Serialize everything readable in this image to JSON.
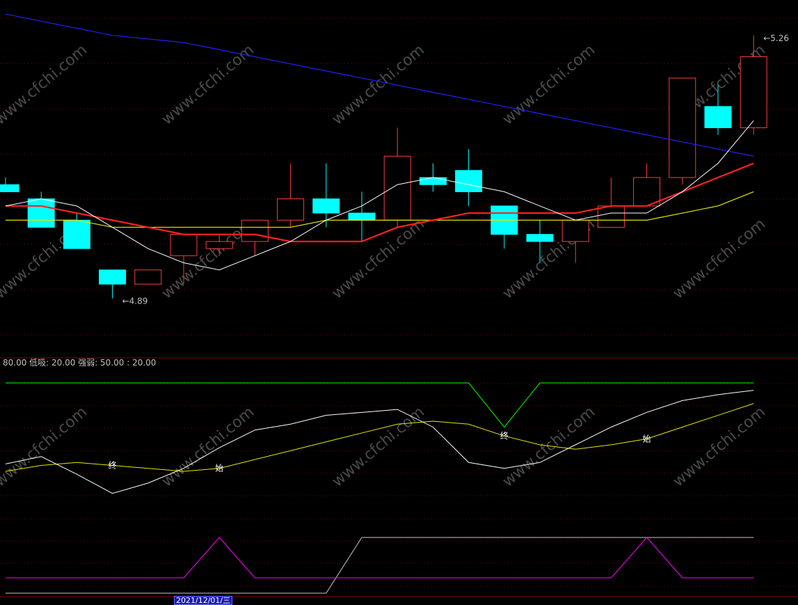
{
  "indicator_text": "80.00  低吸: 20.00  强弱: 50.00 : 20.00",
  "date_label": "2021/12/01/三",
  "watermark": "www.cfchi.com",
  "colors": {
    "bg": "#000000",
    "up": "#ff3c3c",
    "down": "#00ffff",
    "ma5": "#ffffff",
    "ma10": "#ff2020",
    "ma20": "#e8e800",
    "ma60": "#2020ff",
    "grid": "#800000",
    "osc_top": "#00ff00",
    "osc_k": "#ffffff",
    "osc_d": "#e8e800",
    "signal_magenta": "#ff00ff",
    "signal_white": "#c8c8c8"
  },
  "chart_data": [
    {
      "type": "candlestick",
      "title": "",
      "ylim": [
        4.82,
        5.3
      ],
      "candles": [
        {
          "o": 5.05,
          "h": 5.06,
          "l": 5.04,
          "c": 5.04
        },
        {
          "o": 5.03,
          "h": 5.04,
          "l": 4.99,
          "c": 4.99
        },
        {
          "o": 5.0,
          "h": 5.01,
          "l": 4.96,
          "c": 4.96
        },
        {
          "o": 4.93,
          "h": 4.93,
          "l": 4.89,
          "c": 4.91
        },
        {
          "o": 4.91,
          "h": 4.93,
          "l": 4.91,
          "c": 4.93
        },
        {
          "o": 4.95,
          "h": 4.98,
          "l": 4.91,
          "c": 4.98
        },
        {
          "o": 4.96,
          "h": 4.98,
          "l": 4.95,
          "c": 4.97
        },
        {
          "o": 4.97,
          "h": 5.0,
          "l": 4.95,
          "c": 5.0
        },
        {
          "o": 5.0,
          "h": 5.08,
          "l": 4.99,
          "c": 5.03
        },
        {
          "o": 5.03,
          "h": 5.08,
          "l": 4.99,
          "c": 5.01
        },
        {
          "o": 5.01,
          "h": 5.04,
          "l": 4.97,
          "c": 5.0
        },
        {
          "o": 5.0,
          "h": 5.13,
          "l": 4.99,
          "c": 5.09
        },
        {
          "o": 5.06,
          "h": 5.08,
          "l": 5.04,
          "c": 5.05
        },
        {
          "o": 5.07,
          "h": 5.1,
          "l": 5.02,
          "c": 5.04
        },
        {
          "o": 5.02,
          "h": 5.02,
          "l": 4.96,
          "c": 4.98
        },
        {
          "o": 4.98,
          "h": 5.0,
          "l": 4.94,
          "c": 4.97
        },
        {
          "o": 4.97,
          "h": 5.0,
          "l": 4.94,
          "c": 5.0
        },
        {
          "o": 4.99,
          "h": 5.06,
          "l": 4.99,
          "c": 5.02
        },
        {
          "o": 5.02,
          "h": 5.08,
          "l": 5.02,
          "c": 5.06
        },
        {
          "o": 5.06,
          "h": 5.2,
          "l": 5.05,
          "c": 5.2
        },
        {
          "o": 5.16,
          "h": 5.19,
          "l": 5.12,
          "c": 5.13
        },
        {
          "o": 5.13,
          "h": 5.26,
          "l": 5.12,
          "c": 5.23
        }
      ],
      "ma5": [
        5.02,
        5.03,
        5.02,
        4.99,
        4.96,
        4.94,
        4.93,
        4.95,
        4.97,
        5.0,
        5.02,
        5.05,
        5.06,
        5.05,
        5.04,
        5.02,
        5.0,
        5.01,
        5.01,
        5.04,
        5.08,
        5.14
      ],
      "ma10": [
        5.02,
        5.02,
        5.01,
        5.0,
        4.99,
        4.98,
        4.98,
        4.98,
        4.97,
        4.97,
        4.97,
        4.99,
        5.0,
        5.01,
        5.01,
        5.01,
        5.01,
        5.02,
        5.02,
        5.04,
        5.06,
        5.08
      ],
      "ma20": [
        5.0,
        5.0,
        5.0,
        4.99,
        4.99,
        4.99,
        4.99,
        4.99,
        4.99,
        5.0,
        5.0,
        5.0,
        5.0,
        5.0,
        5.0,
        5.0,
        5.0,
        5.0,
        5.0,
        5.01,
        5.02,
        5.04
      ],
      "ma60": [
        5.29,
        5.28,
        5.27,
        5.26,
        5.255,
        5.25,
        5.24,
        5.23,
        5.22,
        5.21,
        5.2,
        5.19,
        5.18,
        5.17,
        5.16,
        5.15,
        5.14,
        5.13,
        5.12,
        5.11,
        5.1,
        5.09
      ],
      "annotations": [
        {
          "label": "5.26",
          "index": 21,
          "value": 5.26
        },
        {
          "label": "4.89",
          "index": 3,
          "value": 4.89
        }
      ]
    },
    {
      "type": "line",
      "title": "",
      "ylim": [
        0,
        100
      ],
      "top_line": [
        100,
        100,
        100,
        100,
        100,
        100,
        100,
        100,
        100,
        100,
        100,
        100,
        100,
        100,
        70,
        100,
        100,
        100,
        100,
        100,
        100,
        100
      ],
      "k": [
        45,
        50,
        38,
        25,
        32,
        42,
        56,
        68,
        72,
        78,
        80,
        82,
        70,
        46,
        42,
        46,
        58,
        70,
        80,
        88,
        92,
        95
      ],
      "d": [
        40,
        44,
        46,
        44,
        42,
        40,
        42,
        48,
        54,
        60,
        66,
        72,
        74,
        72,
        64,
        58,
        55,
        58,
        62,
        70,
        78,
        86
      ],
      "markers": [
        {
          "label": "终",
          "index": 3
        },
        {
          "label": "始",
          "index": 6
        },
        {
          "label": "终",
          "index": 14
        },
        {
          "label": "始",
          "index": 18
        }
      ]
    },
    {
      "type": "line",
      "title": "",
      "ylim": [
        0,
        1
      ],
      "magenta": [
        0,
        0,
        0,
        0,
        0,
        0,
        1,
        0,
        0,
        0,
        0,
        0,
        0,
        0,
        0,
        0,
        0,
        0,
        1,
        0,
        0,
        0
      ],
      "white": [
        0,
        0,
        0,
        0,
        0,
        0,
        0,
        0,
        0,
        0,
        1,
        1,
        1,
        1,
        1,
        1,
        1,
        1,
        1,
        1,
        1,
        1
      ]
    }
  ]
}
